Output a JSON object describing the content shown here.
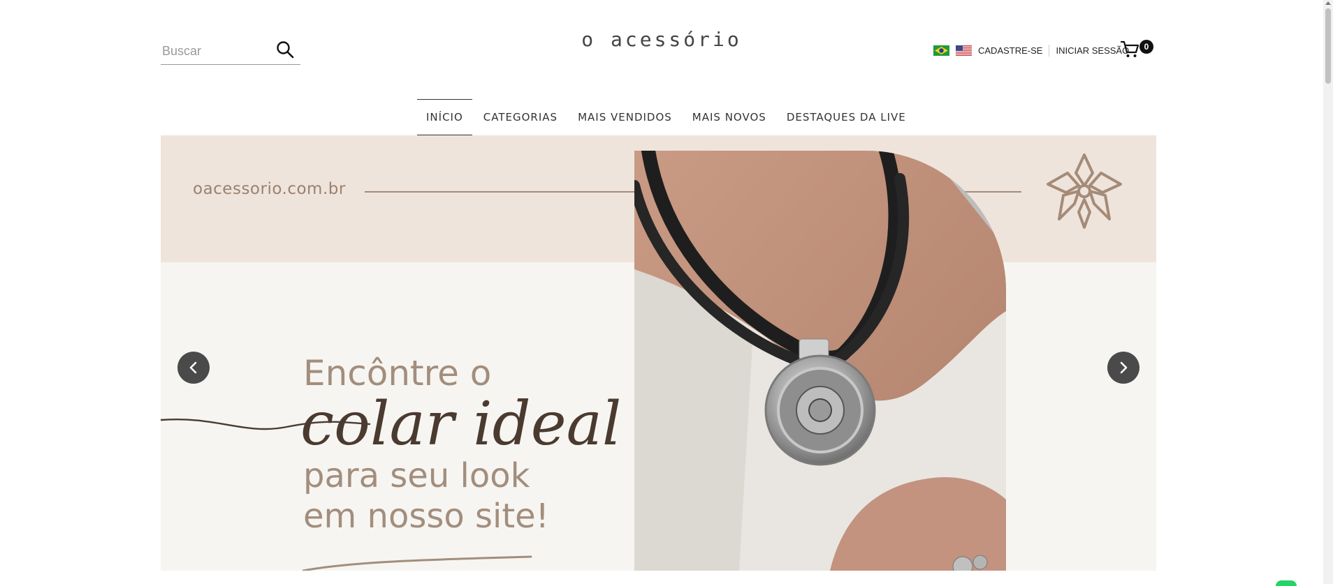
{
  "search": {
    "placeholder": "Buscar"
  },
  "logo": {
    "text": "o acessório"
  },
  "user_links": {
    "register": "CADASTRE-SE",
    "login": "INICIAR SESSÃO"
  },
  "flags": [
    "brazil-flag-icon",
    "usa-flag-icon"
  ],
  "cart": {
    "count": "0"
  },
  "nav": {
    "items": [
      {
        "label": "INÍCIO",
        "active": true
      },
      {
        "label": "CATEGORIAS"
      },
      {
        "label": "MAIS VENDIDOS"
      },
      {
        "label": "MAIS NOVOS"
      },
      {
        "label": "DESTAQUES DA LIVE"
      }
    ]
  },
  "banner": {
    "url": "oacessorio.com.br",
    "line1": "Encôntre o",
    "line2": "colar ideal",
    "line3": "para seu look",
    "line4": "em nosso site!"
  },
  "colors": {
    "banner_top_bg": "#efe4db",
    "banner_text": "#a28e7d",
    "banner_script": "#4a3a2f",
    "accent_line": "#a48b78"
  }
}
